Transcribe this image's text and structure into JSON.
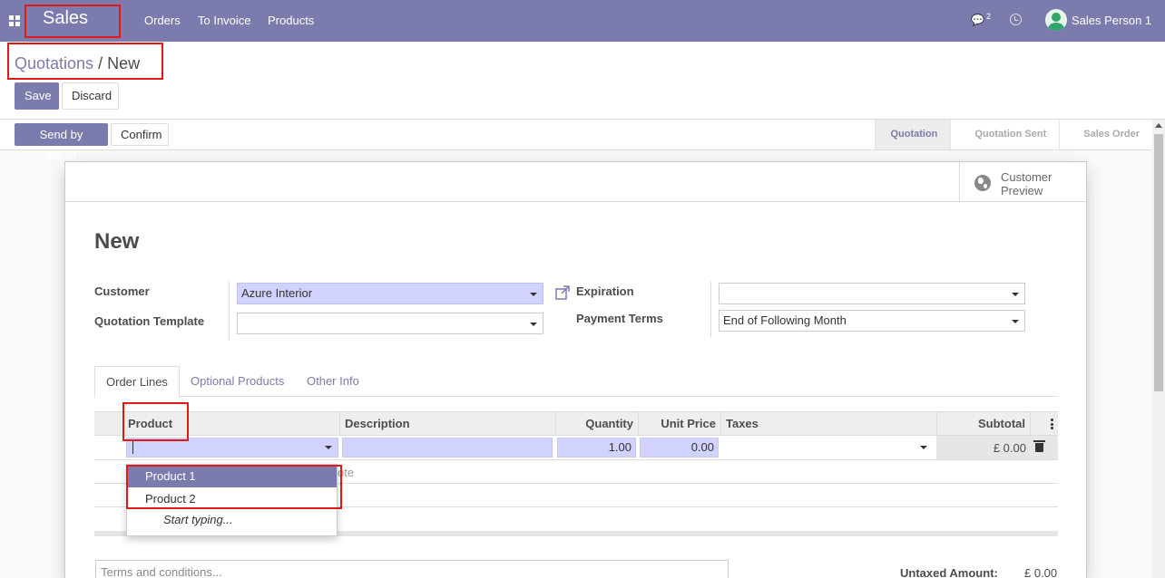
{
  "navbar": {
    "brand": "Sales",
    "menu": [
      "Orders",
      "To Invoice",
      "Products"
    ],
    "message_count": "2",
    "user_name": "Sales Person 1"
  },
  "breadcrumb": {
    "parent": "Quotations",
    "separator": "/",
    "current": "New"
  },
  "toolbar": {
    "save_label": "Save",
    "discard_label": "Discard"
  },
  "statusbar": {
    "send_email_label": "Send by Email",
    "confirm_label": "Confirm",
    "steps": [
      "Quotation",
      "Quotation Sent",
      "Sales Order"
    ],
    "active_step": "Quotation"
  },
  "smart_button": {
    "label_line1": "Customer",
    "label_line2": "Preview"
  },
  "form": {
    "title": "New",
    "customer_label": "Customer",
    "customer_value": "Azure Interior",
    "template_label": "Quotation Template",
    "template_value": "",
    "expiration_label": "Expiration",
    "expiration_value": "",
    "payment_terms_label": "Payment Terms",
    "payment_terms_value": "End of Following Month"
  },
  "tabs": [
    "Order Lines",
    "Optional Products",
    "Other Info"
  ],
  "table": {
    "columns": {
      "product": "Product",
      "description": "Description",
      "quantity": "Quantity",
      "unit_price": "Unit Price",
      "taxes": "Taxes",
      "subtotal": "Subtotal"
    },
    "row": {
      "product": "",
      "description": "",
      "quantity": "1.00",
      "unit_price": "0.00",
      "taxes": "",
      "subtotal": "£ 0.00"
    },
    "add_note_fragment": "ote"
  },
  "autocomplete": {
    "options": [
      "Product 1",
      "Product 2"
    ],
    "hint": "Start typing..."
  },
  "footer": {
    "terms_placeholder": "Terms and conditions...",
    "untaxed_label": "Untaxed Amount:",
    "untaxed_value": "£ 0.00"
  },
  "colors": {
    "brand": "#7c7bad",
    "required_field": "#d2d2ff",
    "highlight_box": "#e01818"
  }
}
